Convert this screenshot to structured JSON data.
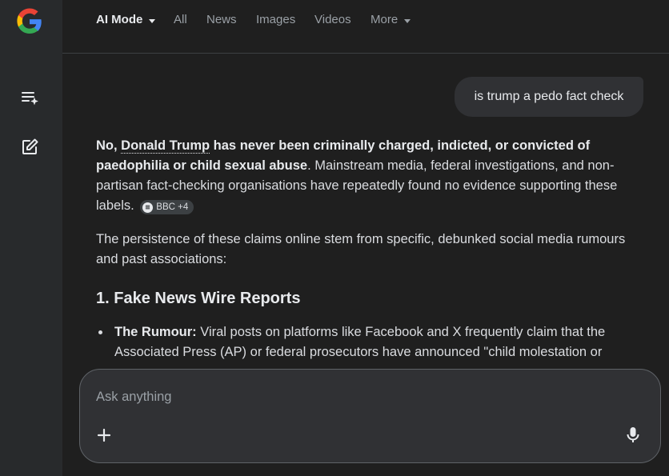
{
  "tabs": [
    {
      "label": "AI Mode",
      "active": true,
      "dropdown": true
    },
    {
      "label": "All"
    },
    {
      "label": "News"
    },
    {
      "label": "Images"
    },
    {
      "label": "Videos"
    },
    {
      "label": "More",
      "dropdown": true
    }
  ],
  "sidebar": {
    "icons": [
      "google-logo-icon",
      "ai-history-icon",
      "new-chat-icon"
    ]
  },
  "query": "is trump a pedo fact check",
  "answer": {
    "p1_no": "No, ",
    "p1_name": "Donald Trump",
    "p1_bold_rest": " has never been criminally charged, indicted, or convicted of paedophilia or child sexual abuse",
    "p1_rest": ". Mainstream media, federal investigations, and non-partisan fact-checking organisations have repeatedly found no evidence supporting these labels.",
    "source_chip": "BBC +4",
    "p2": "The persistence of these claims online stem from specific, debunked social media rumours and past associations:",
    "heading": "1. Fake News Wire Reports",
    "bullet_label": "The Rumour:",
    "bullet_text": " Viral posts on platforms like Facebook and X frequently claim that the Associated Press (AP) or federal prosecutors have announced \"child molestation or"
  },
  "ask": {
    "placeholder": "Ask anything"
  },
  "colors": {
    "background": "#1f1f1f",
    "sidebar": "#282a2c",
    "bubble": "#303134",
    "text": "#dadce0",
    "muted": "#9aa0a6"
  }
}
